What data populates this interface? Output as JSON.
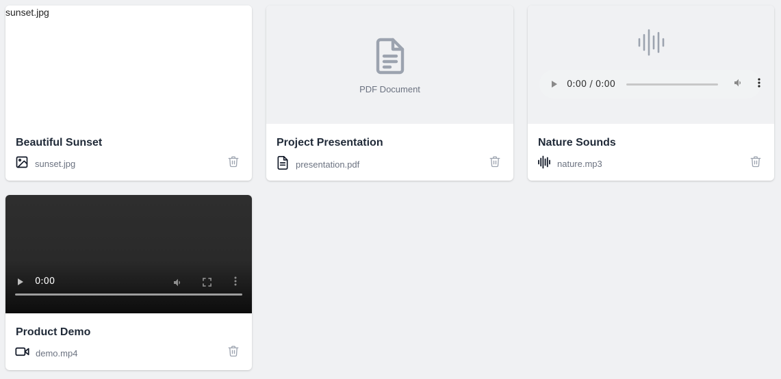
{
  "cards": [
    {
      "title": "Beautiful Sunset",
      "filename": "sunset.jpg",
      "type": "image",
      "preview_alt": "sunset.jpg",
      "type_icon": "image-icon",
      "delete_icon": "trash-icon"
    },
    {
      "title": "Project Presentation",
      "filename": "presentation.pdf",
      "type": "pdf",
      "preview_label": "PDF Document",
      "type_icon": "document-icon",
      "delete_icon": "trash-icon"
    },
    {
      "title": "Nature Sounds",
      "filename": "nature.mp3",
      "type": "audio",
      "player_time": "0:00 / 0:00",
      "type_icon": "audio-wave-icon",
      "delete_icon": "trash-icon"
    },
    {
      "title": "Product Demo",
      "filename": "demo.mp4",
      "type": "video",
      "player_time": "0:00",
      "type_icon": "video-icon",
      "delete_icon": "trash-icon"
    }
  ],
  "colors": {
    "page_background": "#f0f1f3",
    "card_background": "#ffffff",
    "muted_text": "#6b7280",
    "icon_gray": "#9ca3af",
    "title_text": "#1f2937"
  }
}
